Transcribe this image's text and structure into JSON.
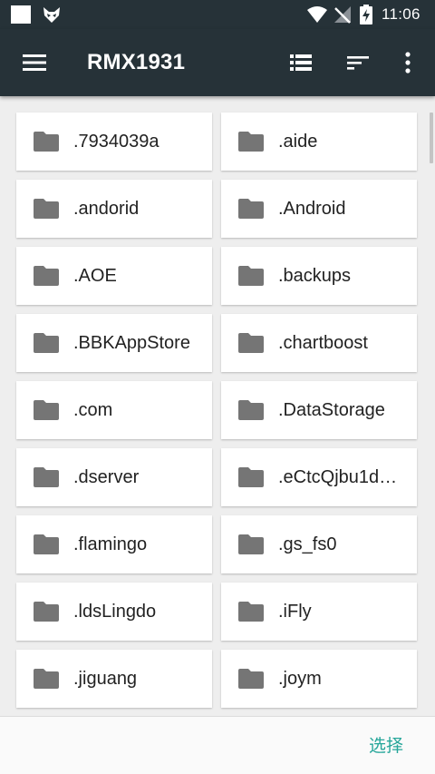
{
  "status_bar": {
    "time": "11:06",
    "icons": [
      "notification-square-icon",
      "fox-icon",
      "wifi-icon",
      "no-signal-icon",
      "battery-charging-icon"
    ]
  },
  "toolbar": {
    "title": "RMX1931",
    "icons": [
      "menu-icon",
      "list-view-icon",
      "sort-icon",
      "more-vert-icon"
    ]
  },
  "folders": [
    ".7934039a",
    ".aide",
    ".andorid",
    ".Android",
    ".AOE",
    ".backups",
    ".BBKAppStore",
    ".chartboost",
    ".com",
    ".DataStorage",
    ".dserver",
    ".eCtcQjbu1d…",
    ".flamingo",
    ".gs_fs0",
    ".ldsLingdo",
    ".iFly",
    ".jiguang",
    ".joym"
  ],
  "bottom": {
    "select_label": "选择"
  },
  "colors": {
    "toolbar": "#263238",
    "accent": "#26a69a",
    "folder_icon": "#757575",
    "background": "#eeeeee"
  }
}
